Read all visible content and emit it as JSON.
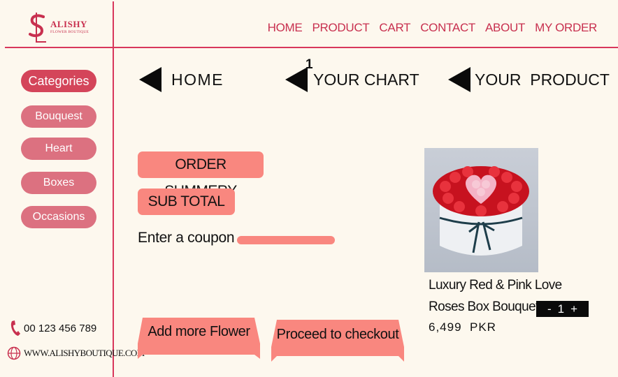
{
  "brand": {
    "name": "ALISHY",
    "tagline": "FLOWER BOUTIQUE"
  },
  "nav": [
    "HOME",
    "PRODUCT",
    "CART",
    "CONTACT",
    "ABOUT",
    "MY ORDER"
  ],
  "sidebar": {
    "title": "Categories",
    "items": [
      "Bouquest",
      "Heart",
      "Boxes",
      "Occasions"
    ]
  },
  "contact": {
    "phone": "00 123 456 789",
    "website": "WWW.ALISHYBOUTIQUE.COM"
  },
  "breadcrumbs": {
    "home": "HOME",
    "chart": "YOUR CHART",
    "chart_badge": "1",
    "product": "YOUR  PRODUCT"
  },
  "order": {
    "summary_label": "ORDER SUMMERY",
    "subtotal_label": "SUB TOTAL",
    "coupon_label": "Enter a coupon",
    "coupon_value": ""
  },
  "actions": {
    "add_more": "Add more Flower",
    "checkout": "Proceed to checkout"
  },
  "product": {
    "name_line1": "Luxury Red & Pink Love",
    "name_line2": "Roses Box Bouquet□",
    "quantity": "1",
    "minus": "-",
    "plus": "+",
    "price": "6,499  PKR"
  },
  "colors": {
    "accent": "#c8304f",
    "divider": "#d8375c",
    "button": "#f9877f",
    "category": "#dc7180",
    "background": "#fdf8ee"
  }
}
